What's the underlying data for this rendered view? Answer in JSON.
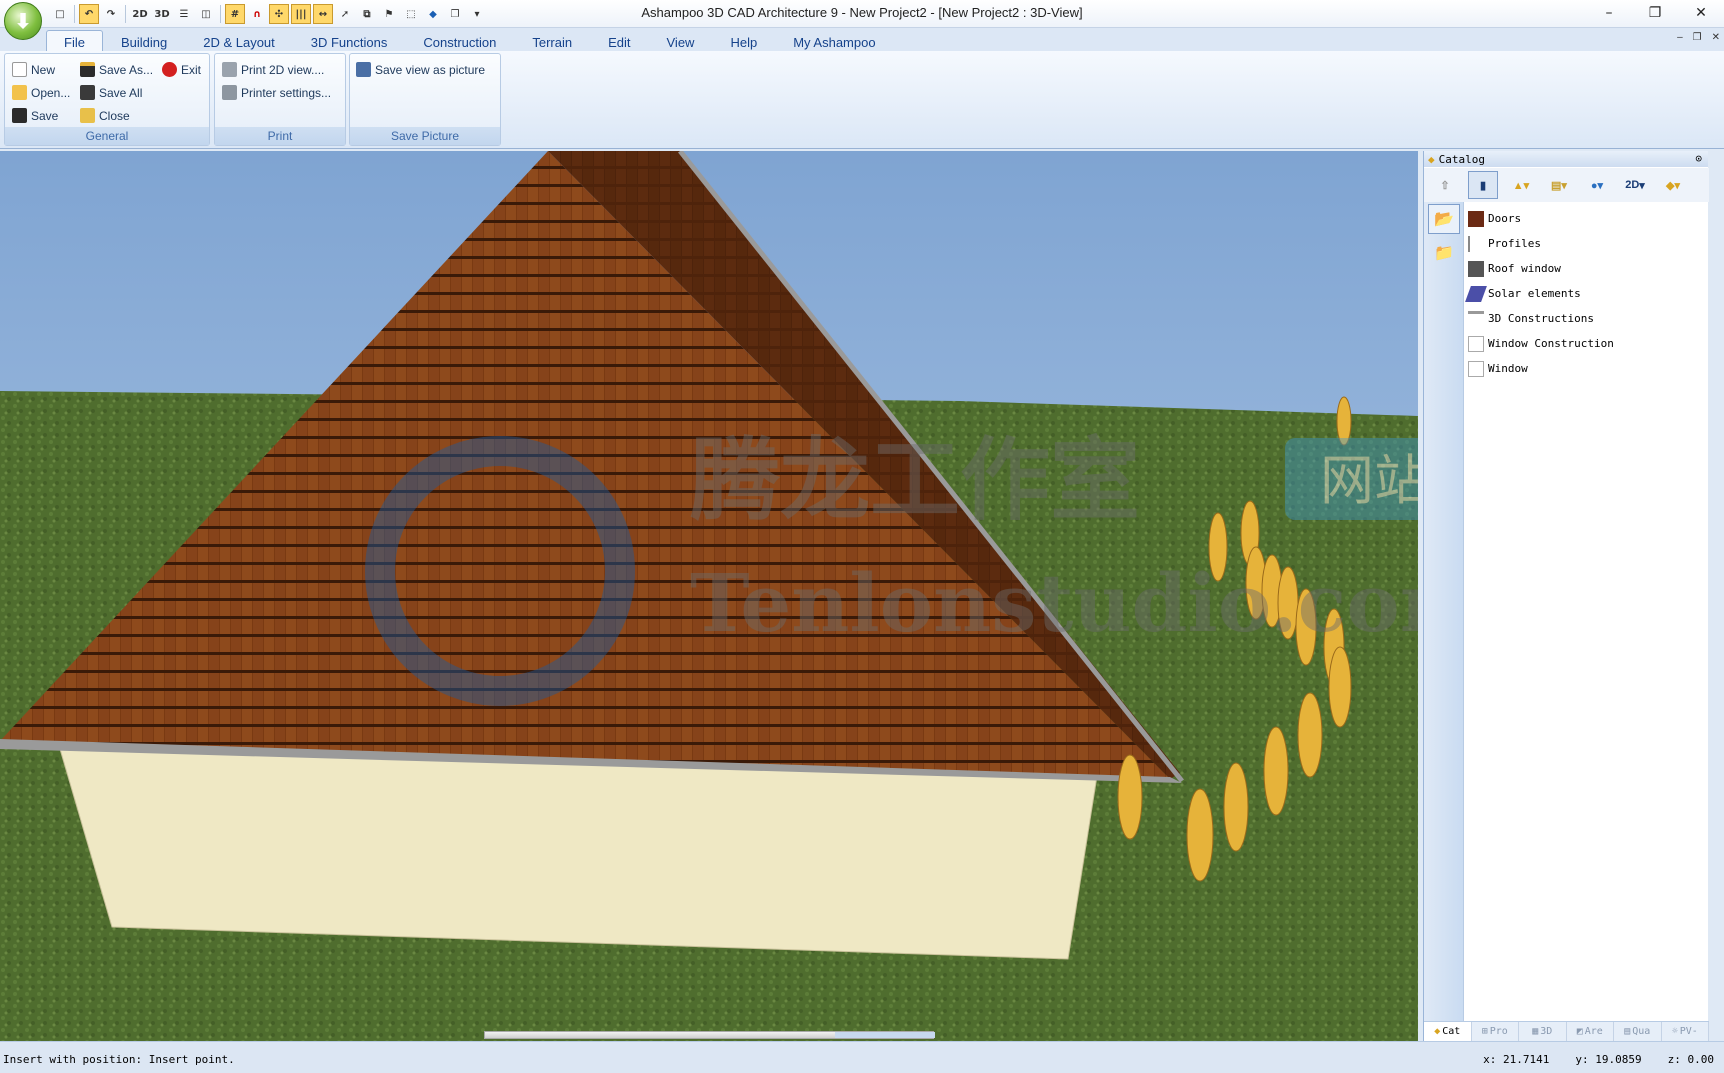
{
  "window": {
    "title": "Ashampoo 3D CAD Architecture 9 - New Project2 - [New Project2 : 3D-View]",
    "minimize": "–",
    "restore": "❐",
    "close": "✕"
  },
  "quick_access": {
    "btn_2d": "2D",
    "btn_3d": "3D"
  },
  "tabs": [
    "File",
    "Building",
    "2D & Layout",
    "3D Functions",
    "Construction",
    "Terrain",
    "Edit",
    "View",
    "Help",
    "My Ashampoo"
  ],
  "ribbon": {
    "general": {
      "label": "General",
      "new": "New",
      "open": "Open...",
      "save": "Save",
      "save_as": "Save As...",
      "save_all": "Save All",
      "close": "Close",
      "exit": "Exit"
    },
    "print": {
      "label": "Print",
      "print_2d": "Print 2D view....",
      "printer_settings": "Printer settings..."
    },
    "save_picture": {
      "label": "Save Picture",
      "save_view": "Save view as picture"
    }
  },
  "catalog": {
    "title": "Catalog",
    "tool_2d": "2D",
    "items": [
      "Doors",
      "Profiles",
      "Roof window",
      "Solar elements",
      "3D Constructions",
      "Window Construction",
      "Window"
    ],
    "bottom_tabs": [
      "Cat",
      "Pro",
      "3D",
      "Are",
      "Qua",
      "PV-"
    ]
  },
  "status": {
    "message": "Insert with position: Insert point.",
    "x": "x: 21.7141",
    "y": "y: 19.0859",
    "z": "z: 0.00"
  },
  "watermark": {
    "cn_name": "腾龙工作室",
    "badge": "网站",
    "en": "Tenlonstudio.com"
  },
  "colors": {
    "ribbon_text": "#15428b",
    "sky": "#9ab8dc",
    "grass": "#4c6a2c",
    "roof": "#7a3a12",
    "wall": "#f0e9c6"
  }
}
